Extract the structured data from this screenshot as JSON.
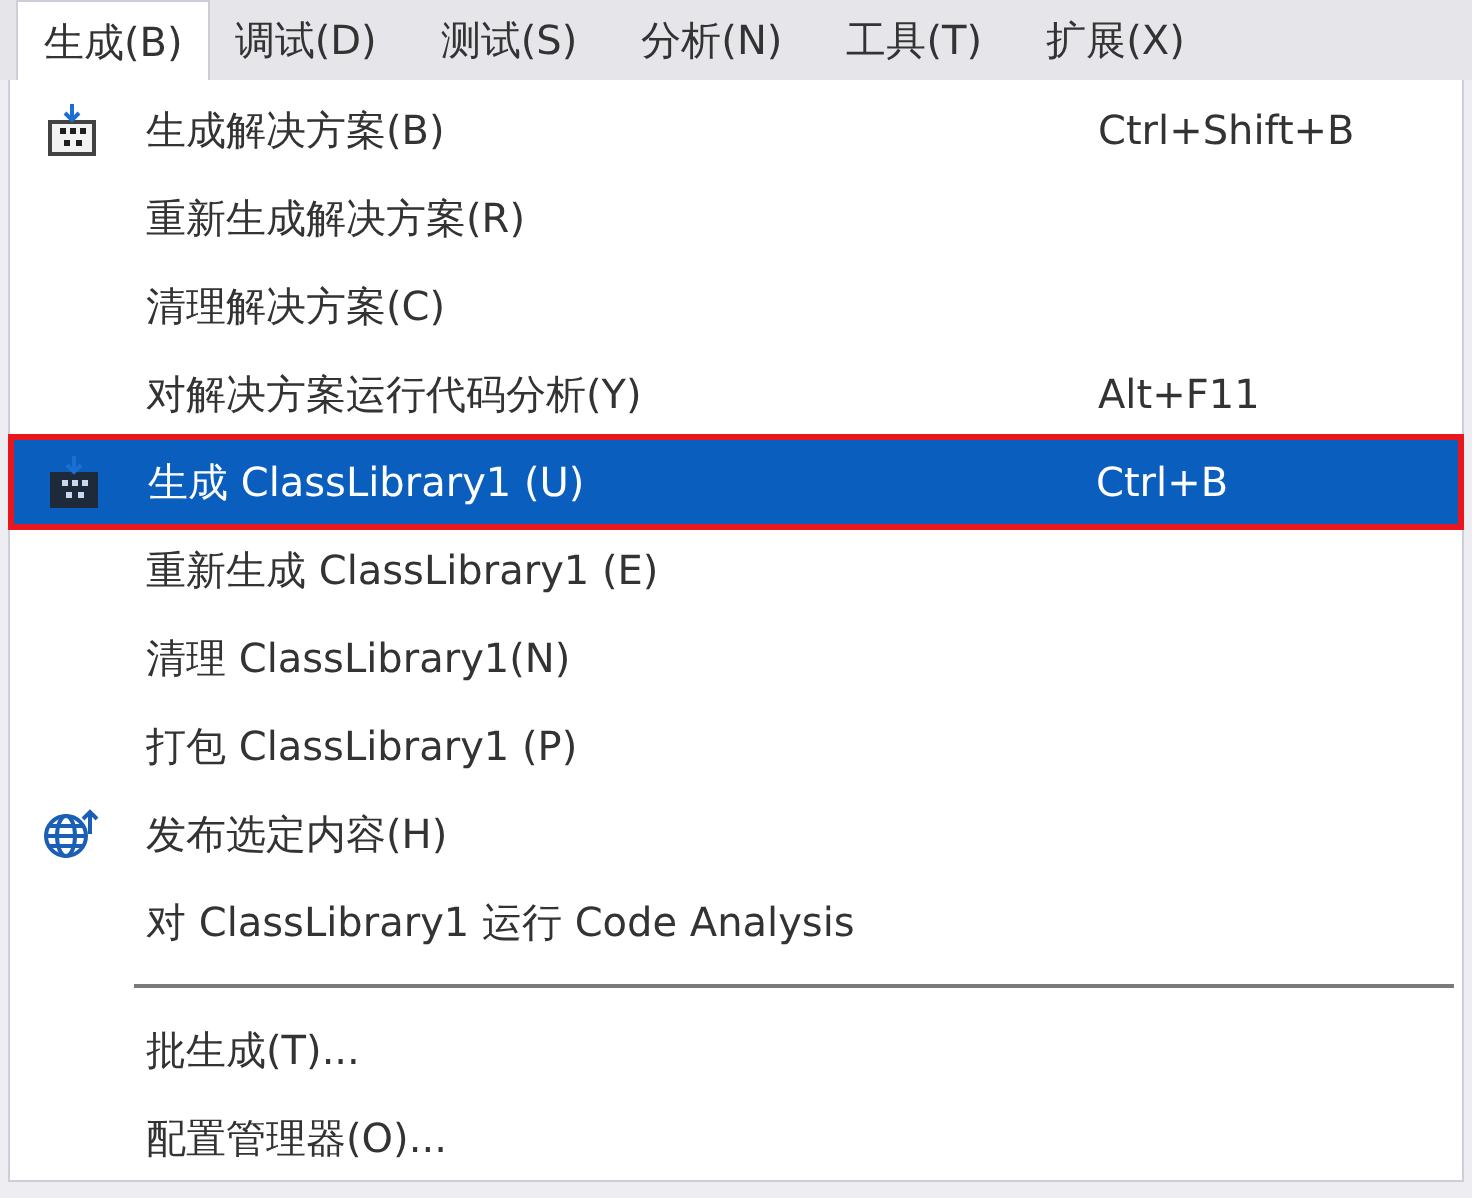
{
  "menu_bar": [
    {
      "label": "生成(B)",
      "selected": true
    },
    {
      "label": "调试(D)",
      "selected": false
    },
    {
      "label": "测试(S)",
      "selected": false
    },
    {
      "label": "分析(N)",
      "selected": false
    },
    {
      "label": "工具(T)",
      "selected": false
    },
    {
      "label": "扩展(X)",
      "selected": false
    }
  ],
  "menu": [
    {
      "kind": "build",
      "label": "生成解决方案(B)",
      "shortcut": "Ctrl+Shift+B",
      "selected": false,
      "outlined": false
    },
    {
      "kind": "item",
      "label": "重新生成解决方案(R)",
      "selected": false,
      "outlined": false
    },
    {
      "kind": "item",
      "label": "清理解决方案(C)",
      "selected": false,
      "outlined": false
    },
    {
      "kind": "item",
      "label": "对解决方案运行代码分析(Y)",
      "shortcut": "Alt+F11",
      "selected": false,
      "outlined": false
    },
    {
      "kind": "build",
      "label": "生成 ClassLibrary1 (U)",
      "shortcut": "Ctrl+B",
      "selected": true,
      "outlined": true
    },
    {
      "kind": "item",
      "label": "重新生成 ClassLibrary1 (E)",
      "selected": false,
      "outlined": false
    },
    {
      "kind": "item",
      "label": "清理 ClassLibrary1(N)",
      "selected": false,
      "outlined": false
    },
    {
      "kind": "item",
      "label": "打包 ClassLibrary1 (P)",
      "selected": false,
      "outlined": false
    },
    {
      "kind": "globe",
      "label": "发布选定内容(H)",
      "selected": false,
      "outlined": false
    },
    {
      "kind": "item",
      "label": "对 ClassLibrary1 运行 Code Analysis",
      "selected": false,
      "outlined": false
    },
    {
      "kind": "separator"
    },
    {
      "kind": "item",
      "label": "批生成(T)...",
      "selected": false,
      "outlined": false
    },
    {
      "kind": "item",
      "label": "配置管理器(O)...",
      "selected": false,
      "outlined": false
    }
  ]
}
